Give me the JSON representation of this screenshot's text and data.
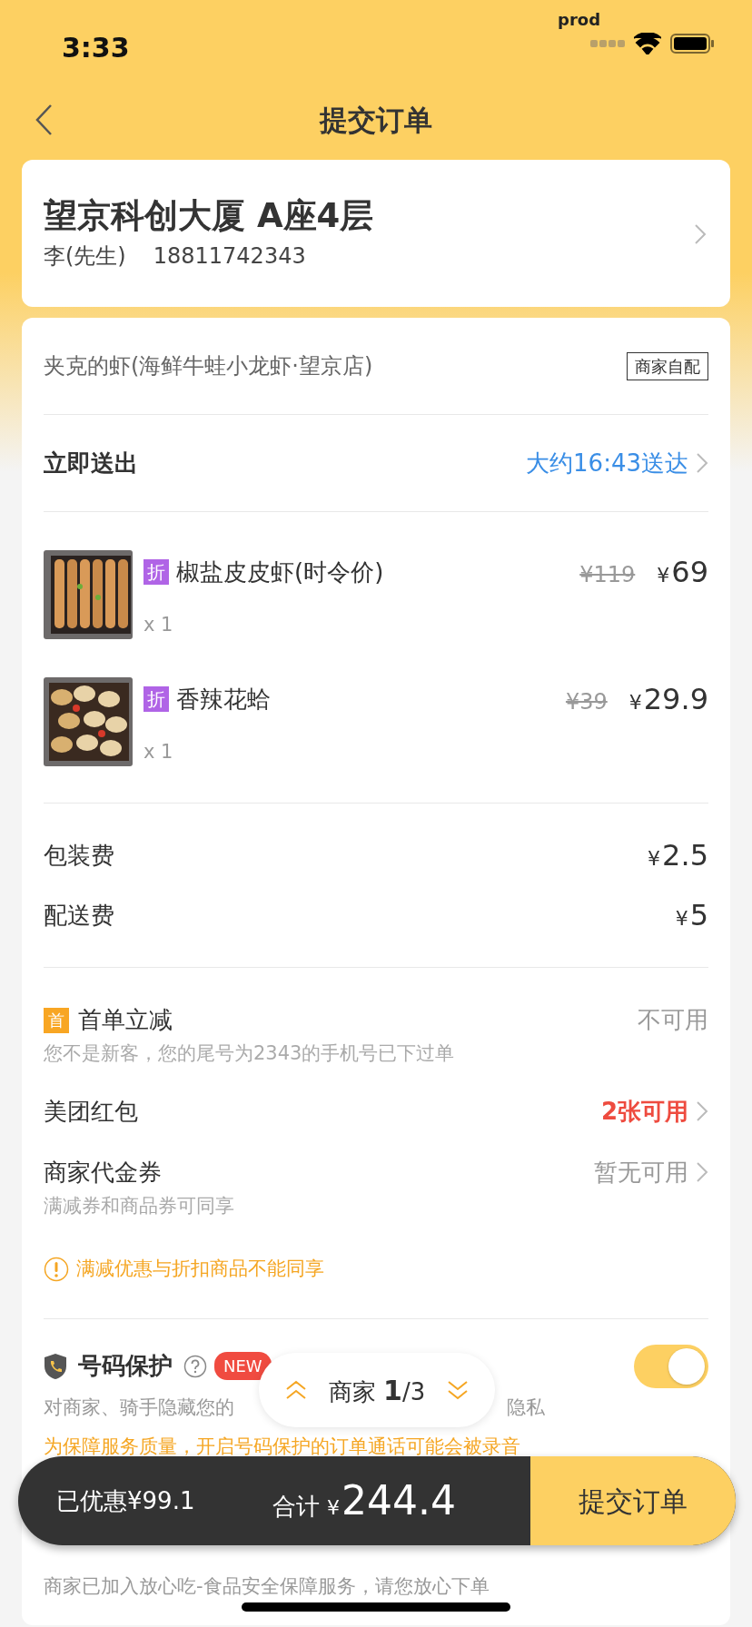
{
  "status_bar": {
    "time": "3:33",
    "carrier": "prod"
  },
  "nav": {
    "title": "提交订单"
  },
  "address": {
    "line": "望京科创大厦 A座4层",
    "contact": "李(先生)",
    "phone": "18811742343"
  },
  "store": {
    "name": "夹克的虾(海鲜牛蛙小龙虾·望京店)",
    "tag": "商家自配"
  },
  "delivery": {
    "label": "立即送出",
    "eta": "大约16:43送达"
  },
  "items": [
    {
      "kind": "shrimp",
      "badge": "折",
      "name": "椒盐皮皮虾(时令价)",
      "original_price": "¥119",
      "symbol": "¥",
      "price": "69",
      "qty": "x 1"
    },
    {
      "kind": "clam",
      "badge": "折",
      "name": "香辣花蛤",
      "original_price": "¥39",
      "symbol": "¥",
      "price": "29.9",
      "qty": "x 1"
    }
  ],
  "fees": [
    {
      "label": "包装费",
      "symbol": "¥",
      "amount": "2.5"
    },
    {
      "label": "配送费",
      "symbol": "¥",
      "amount": "5"
    }
  ],
  "discounts": [
    {
      "badge": "首",
      "label": "首单立减",
      "value": "不可用",
      "note": "您不是新客，您的尾号为2343的手机号已下过单",
      "highlight": false,
      "chevron": false
    },
    {
      "label": "美团红包",
      "value": "2张可用",
      "highlight": true,
      "chevron": true
    },
    {
      "label": "商家代金券",
      "value": "暂无可用",
      "note": "满减券和商品券可同享",
      "highlight": false,
      "chevron": true
    }
  ],
  "warning": "满减优惠与折扣商品不能同享",
  "privacy": {
    "label": "号码保护",
    "badge": "NEW",
    "on": true,
    "note_left": "对商家、骑手隐藏您的",
    "note_right": "隐私",
    "record_note": "为保障服务质量，开启号码保护的订单通话可能会被录音"
  },
  "pager": {
    "label": "商家",
    "current": "1",
    "total": "/3"
  },
  "footer": {
    "saved": "已优惠¥99.1",
    "total_label": "合计",
    "symbol": "¥",
    "total": "244.4",
    "submit": "提交订单"
  },
  "assurance": "商家已加入放心吃-食品安全保障服务，请您放心下单"
}
